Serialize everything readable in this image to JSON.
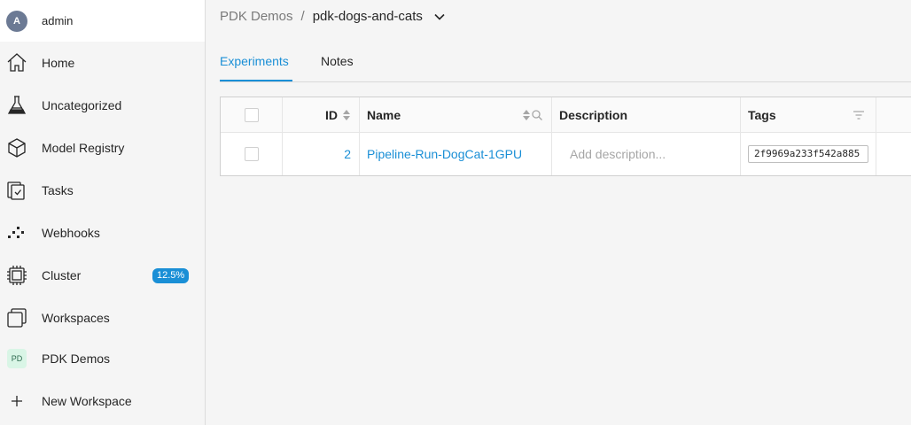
{
  "user": {
    "initial": "A",
    "name": "admin"
  },
  "sidebar": {
    "items": [
      {
        "label": "Home",
        "icon": "home-icon"
      },
      {
        "label": "Uncategorized",
        "icon": "flask-icon"
      },
      {
        "label": "Model Registry",
        "icon": "cube-icon"
      },
      {
        "label": "Tasks",
        "icon": "tasks-icon"
      },
      {
        "label": "Webhooks",
        "icon": "webhooks-icon"
      },
      {
        "label": "Cluster",
        "icon": "chip-icon",
        "badge": "12.5%"
      },
      {
        "label": "Workspaces",
        "icon": "workspaces-icon"
      },
      {
        "label": "PDK Demos",
        "icon": "workspace-tile",
        "tile": "PD"
      },
      {
        "label": "New Workspace",
        "icon": "plus-icon"
      }
    ]
  },
  "breadcrumb": {
    "parent": "PDK Demos",
    "separator": "/",
    "current": "pdk-dogs-and-cats"
  },
  "tabs": [
    {
      "label": "Experiments",
      "active": true
    },
    {
      "label": "Notes",
      "active": false
    }
  ],
  "table": {
    "columns": {
      "id": "ID",
      "name": "Name",
      "description": "Description",
      "tags": "Tags"
    },
    "rows": [
      {
        "id": "2",
        "name": "Pipeline-Run-DogCat-1GPU",
        "description_placeholder": "Add description...",
        "tag": "2f9969a233f542a885"
      }
    ]
  },
  "colors": {
    "accent": "#1a8fd6",
    "badge": "#1a8fd6",
    "avatar": "#6c7a94",
    "workspace_tile": "#d9f5e6"
  }
}
